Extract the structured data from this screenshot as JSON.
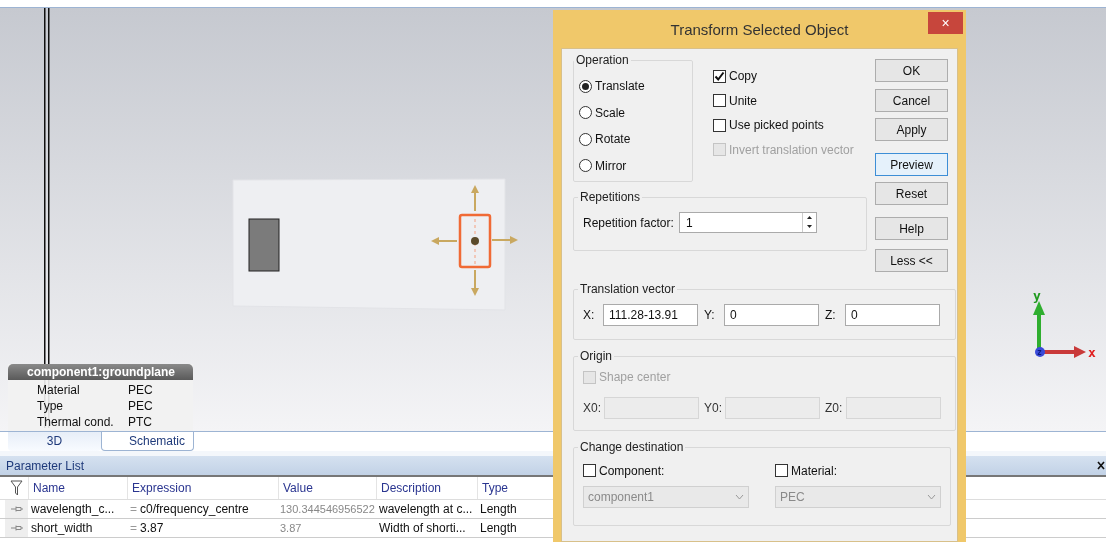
{
  "viewport": {
    "properties": {
      "title": "component1:groundplane",
      "rows": [
        {
          "label": "Material",
          "value": "PEC"
        },
        {
          "label": "Type",
          "value": "PEC"
        },
        {
          "label": "Thermal cond.",
          "value": "PTC"
        }
      ]
    },
    "axes": {
      "x": "x",
      "y": "y",
      "z": "z"
    }
  },
  "view_tabs": [
    {
      "label": "3D",
      "selected": true
    },
    {
      "label": "Schematic",
      "selected": false
    }
  ],
  "parameter_list": {
    "title": "Parameter List",
    "columns": [
      "Name",
      "Expression",
      "Value",
      "Description",
      "Type"
    ],
    "rows": [
      {
        "name": "wavelength_c...",
        "equals": "=",
        "expression": "c0/frequency_centre",
        "value": "130.344546956522",
        "description": "wavelength at c...",
        "type": "Length"
      },
      {
        "name": "short_width",
        "equals": "=",
        "expression": "3.87",
        "value": "3.87",
        "description": "Width of shorti...",
        "type": "Length"
      }
    ]
  },
  "dialog": {
    "title": "Transform Selected Object",
    "close": "×",
    "operation": {
      "title": "Operation",
      "options": [
        {
          "label": "Translate",
          "selected": true
        },
        {
          "label": "Scale",
          "selected": false
        },
        {
          "label": "Rotate",
          "selected": false
        },
        {
          "label": "Mirror",
          "selected": false
        }
      ]
    },
    "checkboxes": [
      {
        "label": "Copy",
        "checked": true,
        "disabled": false
      },
      {
        "label": "Unite",
        "checked": false,
        "disabled": false
      },
      {
        "label": "Use picked points",
        "checked": false,
        "disabled": false
      },
      {
        "label": "Invert translation vector",
        "checked": false,
        "disabled": true
      }
    ],
    "buttons": [
      {
        "label": "OK",
        "focused": false
      },
      {
        "label": "Cancel",
        "focused": false
      },
      {
        "label": "Apply",
        "focused": false
      },
      {
        "label": "Preview",
        "focused": true
      },
      {
        "label": "Reset",
        "focused": false
      },
      {
        "label": "Help",
        "focused": false
      },
      {
        "label": "Less <<",
        "focused": false
      }
    ],
    "repetitions": {
      "title": "Repetitions",
      "label": "Repetition factor:",
      "value": "1"
    },
    "translation": {
      "title": "Translation vector",
      "fields": [
        {
          "label": "X:",
          "value": "111.28-13.91"
        },
        {
          "label": "Y:",
          "value": "0"
        },
        {
          "label": "Z:",
          "value": "0"
        }
      ]
    },
    "origin": {
      "title": "Origin",
      "disabled": true,
      "checkbox": {
        "label": "Shape center",
        "checked": false,
        "disabled": true
      },
      "fields": [
        {
          "label": "X0:"
        },
        {
          "label": "Y0:"
        },
        {
          "label": "Z0:"
        }
      ]
    },
    "destination": {
      "title": "Change destination",
      "items": [
        {
          "label": "Component:",
          "checked": false,
          "value": "component1",
          "disabled": true
        },
        {
          "label": "Material:",
          "checked": false,
          "value": "PEC",
          "disabled": true
        }
      ]
    }
  }
}
